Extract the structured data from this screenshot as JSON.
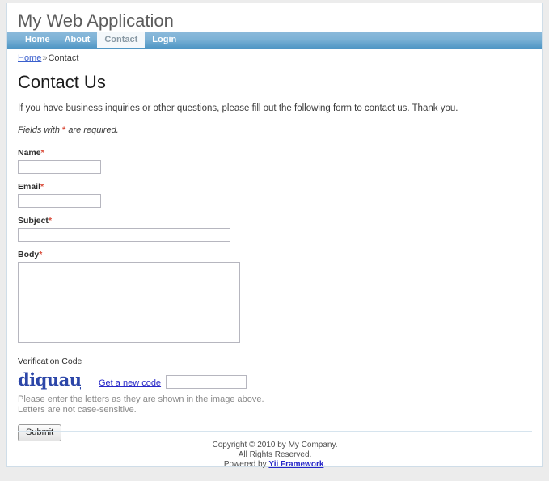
{
  "site": {
    "title": "My Web Application"
  },
  "nav": {
    "items": [
      {
        "label": "Home",
        "active": false
      },
      {
        "label": "About",
        "active": false
      },
      {
        "label": "Contact",
        "active": true
      },
      {
        "label": "Login",
        "active": false
      }
    ]
  },
  "breadcrumb": {
    "home": "Home",
    "separator": "»",
    "current": "Contact"
  },
  "page": {
    "heading": "Contact Us",
    "intro": "If you have business inquiries or other questions, please fill out the following form to contact us. Thank you.",
    "note_prefix": "Fields with ",
    "note_asterisk": "*",
    "note_suffix": " are required."
  },
  "form": {
    "name": {
      "label": "Name",
      "required": "*",
      "value": "",
      "placeholder": ""
    },
    "email": {
      "label": "Email",
      "required": "*",
      "value": "",
      "placeholder": ""
    },
    "subject": {
      "label": "Subject",
      "required": "*",
      "value": "",
      "placeholder": ""
    },
    "body": {
      "label": "Body",
      "required": "*",
      "value": "",
      "placeholder": ""
    },
    "captcha": {
      "label": "Verification Code",
      "code_text": "diquauj",
      "code_color": "#2c46a8",
      "new_code_link": "Get a new code",
      "value": "",
      "placeholder": "",
      "hint_line1": "Please enter the letters as they are shown in the image above.",
      "hint_line2": "Letters are not case-sensitive."
    },
    "submit_label": "Submit"
  },
  "footer": {
    "line1": "Copyright © 2010 by My Company.",
    "line2": "All Rights Reserved.",
    "powered_prefix": "Powered by ",
    "powered_link": "Yii Framework",
    "powered_suffix": "."
  },
  "colors": {
    "nav_top": "#8cbadb",
    "nav_bottom": "#4e95c4",
    "link": "#2626c8",
    "required": "#d94a38",
    "page_border": "#cfdde8"
  }
}
